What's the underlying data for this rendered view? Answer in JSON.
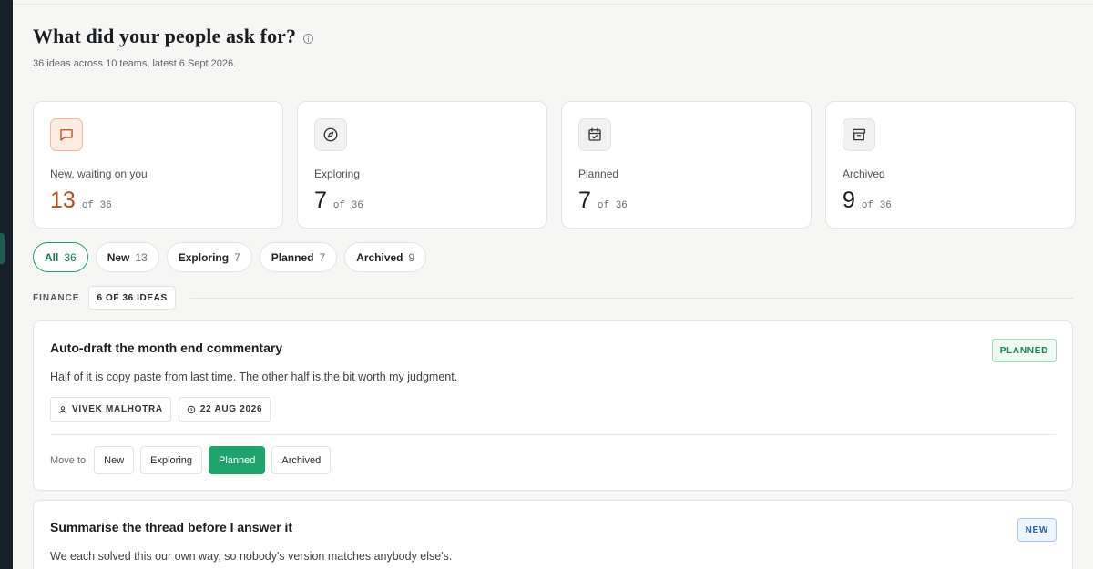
{
  "colors": {
    "accent_orange": "#b5501c",
    "accent_green": "#1fa36d",
    "planned_badge_text": "#16835a",
    "new_badge_text": "#2c5fa9",
    "rail": "#16202b"
  },
  "header": {
    "title": "What did your people ask for?",
    "info_icon": "info-icon",
    "subtitle": "36 ideas across 10 teams, latest 6 Sept 2026."
  },
  "stats": [
    {
      "icon": "message-square-icon",
      "label": "New, waiting on you",
      "value": "13",
      "of": "of 36"
    },
    {
      "icon": "compass-icon",
      "label": "Exploring",
      "value": "7",
      "of": "of 36"
    },
    {
      "icon": "calendar-check-icon",
      "label": "Planned",
      "value": "7",
      "of": "of 36"
    },
    {
      "icon": "archive-icon",
      "label": "Archived",
      "value": "9",
      "of": "of 36"
    }
  ],
  "filters": [
    {
      "label": "All",
      "count": "36",
      "active": true
    },
    {
      "label": "New",
      "count": "13"
    },
    {
      "label": "Exploring",
      "count": "7"
    },
    {
      "label": "Planned",
      "count": "7"
    },
    {
      "label": "Archived",
      "count": "9"
    }
  ],
  "group": {
    "label": "FINANCE",
    "count": "6 OF 36 IDEAS"
  },
  "ideas": [
    {
      "title": "Auto-draft the month end commentary",
      "body": "Half of it is copy paste from last time. The other half is the bit worth my judgment.",
      "status": "PLANNED",
      "author": "VIVEK MALHOTRA",
      "date": "22 AUG 2026",
      "move_label": "Move to",
      "move_options": [
        "New",
        "Exploring",
        "Planned",
        "Archived"
      ],
      "selected": "Planned"
    },
    {
      "title": "Summarise the thread before I answer it",
      "body": "We each solved this our own way, so nobody's version matches anybody else's.",
      "status": "NEW"
    }
  ]
}
